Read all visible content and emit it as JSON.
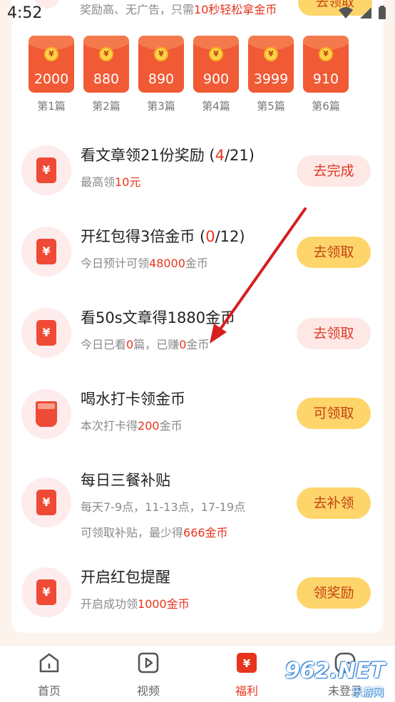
{
  "status_bar": {
    "time": "4:52"
  },
  "top_task": {
    "subtitle_prefix": "奖励高、无广告，只需",
    "subtitle_highlight": "10秒轻松拿金币",
    "button": "去领取"
  },
  "packets": [
    {
      "amount": "2000",
      "label": "第1篇"
    },
    {
      "amount": "880",
      "label": "第2篇"
    },
    {
      "amount": "890",
      "label": "第3篇"
    },
    {
      "amount": "900",
      "label": "第4篇"
    },
    {
      "amount": "3999",
      "label": "第5篇"
    },
    {
      "amount": "910",
      "label": "第6篇"
    }
  ],
  "packet_coin_symbol": "¥",
  "tasks": [
    {
      "title_prefix": "看文章领21份奖励 (",
      "progress_current": "4",
      "title_suffix": "/21)",
      "sub_prefix": "最高领",
      "sub_highlight": "10元",
      "sub_suffix": "",
      "button": "去完成",
      "button_style": "pink",
      "icon": "red-envelope-icon"
    },
    {
      "title_prefix": "开红包得3倍金币 (",
      "progress_current": "0",
      "title_suffix": "/12)",
      "sub_prefix": "今日预计可领",
      "sub_highlight": "48000",
      "sub_suffix": "金币",
      "button": "去领取",
      "button_style": "yellow",
      "icon": "red-envelope-icon"
    },
    {
      "title": "看50s文章得1880金币",
      "sub_prefix": "今日已看",
      "sub_h1": "0",
      "sub_mid": "篇，已赚",
      "sub_h2": "0",
      "sub_suffix": "金币",
      "button": "去领取",
      "button_style": "pink",
      "icon": "red-envelope-icon"
    },
    {
      "title": "喝水打卡领金币",
      "sub_prefix": "本次打卡得",
      "sub_highlight": "200",
      "sub_suffix": "金币",
      "button": "可领取",
      "button_style": "yellow",
      "icon": "water-cup-icon"
    },
    {
      "title": "每日三餐补贴",
      "sub_line1": "每天7-9点，11-13点，17-19点",
      "sub_prefix": "可领取补贴，最少得",
      "sub_highlight": "666金币",
      "button": "去补领",
      "button_style": "yellow",
      "icon": "red-envelope-icon"
    },
    {
      "title": "开启红包提醒",
      "sub_prefix": "开启成功领",
      "sub_highlight": "1000金币",
      "button": "领奖励",
      "button_style": "yellow",
      "icon": "red-envelope-icon"
    }
  ],
  "task_icon_symbol": "¥",
  "nav": [
    {
      "label": "首页",
      "icon": "home-icon",
      "active": false
    },
    {
      "label": "视频",
      "icon": "video-icon",
      "active": false
    },
    {
      "label": "福利",
      "icon": "welfare-icon",
      "active": true
    },
    {
      "label": "未登录",
      "icon": "profile-icon",
      "active": false
    }
  ],
  "watermark": {
    "brand": "962.NET",
    "site": "乐游网"
  },
  "colors": {
    "accent": "#e8341d",
    "button_yellow": "#fdd56a",
    "button_pink": "#fde8e6",
    "packet": "#f05a35"
  }
}
